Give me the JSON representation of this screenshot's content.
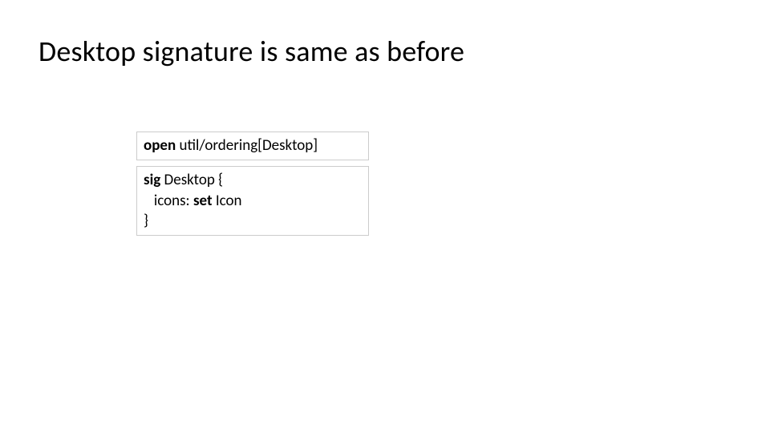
{
  "title": "Desktop signature is same as before",
  "code_open": {
    "keyword": "open",
    "rest": " util/ordering[Desktop]"
  },
  "code_sig": {
    "line1_keyword": "sig",
    "line1_rest": " Desktop {",
    "line2_indent": "   icons: ",
    "line2_keyword": "set",
    "line2_rest": " Icon",
    "line3": "}"
  }
}
